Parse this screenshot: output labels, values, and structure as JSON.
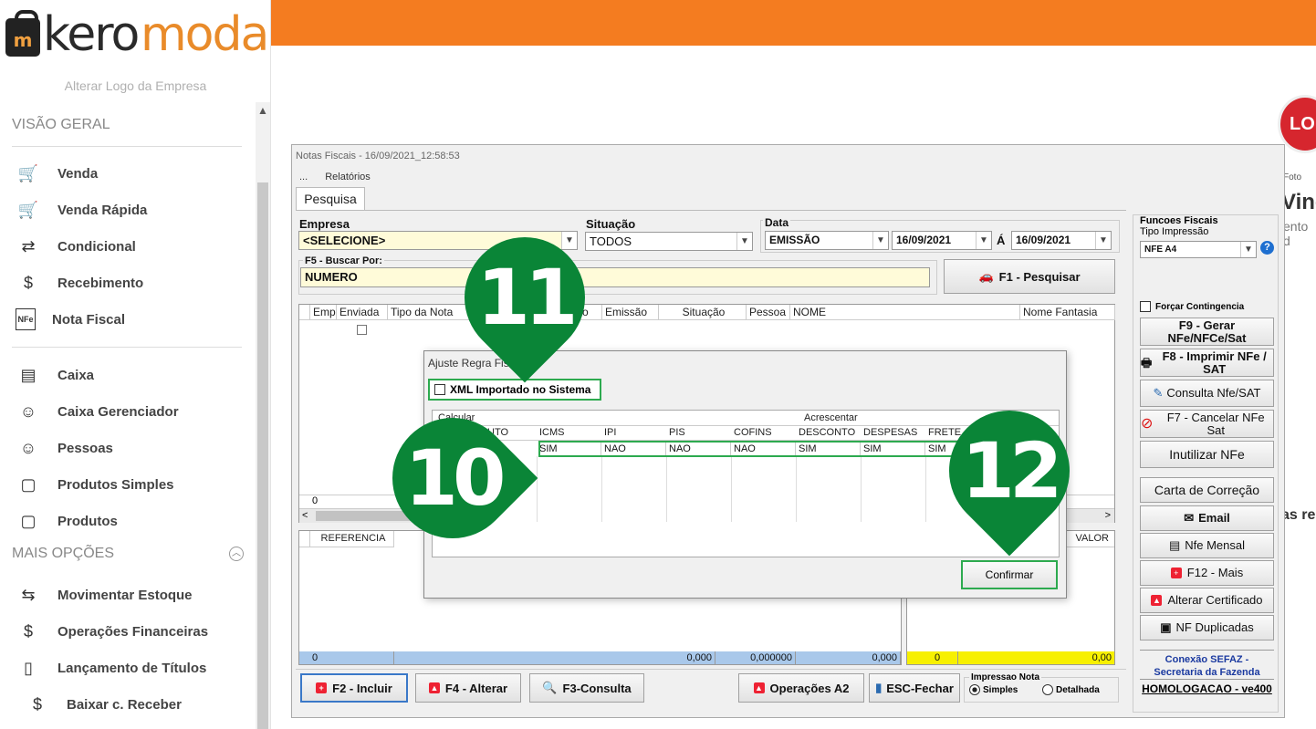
{
  "sidebar": {
    "logo": {
      "part1": "kero",
      "part2": "moda",
      "mark": "m"
    },
    "alter_logo": "Alterar Logo da Empresa",
    "section_overview": "VISÃO GERAL",
    "section_more": "MAIS OPÇÕES",
    "items_overview": [
      {
        "label": "Venda",
        "icon": "cart-icon"
      },
      {
        "label": "Venda Rápida",
        "icon": "cart-icon"
      },
      {
        "label": "Condicional",
        "icon": "cart-arrows-icon"
      },
      {
        "label": "Recebimento",
        "icon": "money-hand-icon"
      },
      {
        "label": "Nota Fiscal",
        "icon": "nfe-icon"
      },
      {
        "label": "Caixa",
        "icon": "cash-register-icon"
      },
      {
        "label": "Caixa Gerenciador",
        "icon": "user-money-icon"
      },
      {
        "label": "Pessoas",
        "icon": "people-icon"
      },
      {
        "label": "Produtos Simples",
        "icon": "box-icon"
      },
      {
        "label": "Produtos",
        "icon": "box-icon"
      }
    ],
    "items_more": [
      {
        "label": "Movimentar Estoque",
        "icon": "stock-move-icon"
      },
      {
        "label": "Operações Financeiras",
        "icon": "dollar-arrows-icon"
      },
      {
        "label": "Lançamento de Títulos",
        "icon": "document-dollar-icon"
      },
      {
        "label": "Baixar c. Receber",
        "icon": "money-hand-icon"
      }
    ]
  },
  "background": {
    "logo_text": "LO",
    "foto_label": "Foto",
    "vind_text": "Vind",
    "ento_text": "ento d",
    "asre_text": "as re"
  },
  "window": {
    "title": "Notas Fiscais - 16/09/2021_12:58:53",
    "menu": [
      "...",
      "Relatórios"
    ],
    "tab": "Pesquisa",
    "empresa_label": "Empresa",
    "empresa_value": "<SELECIONE>",
    "situacao_label": "Situação",
    "situacao_value": "TODOS",
    "data_label": "Data",
    "data_type": "EMISSÃO",
    "date_from": "16/09/2021",
    "date_sep": "Á",
    "date_to": "16/09/2021",
    "buscar_label": "F5 - Buscar Por:",
    "buscar_value": "NUMERO",
    "pesquisar_button": "F1 - Pesquisar",
    "grid_headers": [
      "Emp",
      "Enviada",
      "Tipo da Nota",
      "o",
      "Emissão",
      "Situação",
      "Pessoa",
      "NOME",
      "Nome Fantasia"
    ],
    "grid_count": "0",
    "grid2_header": "REFERENCIA",
    "grid3_header": "VALOR",
    "totals": {
      "t0": "0",
      "t1": "0,000",
      "t2": "0,000000",
      "t3": "0,000",
      "t4": "0",
      "t5": "0,00"
    },
    "right_panel": {
      "title": "Funcoes Fiscais",
      "tipo_label": "Tipo Impressão",
      "tipo_value": "NFE A4",
      "forcar": "Forçar Contingencia",
      "btn_f9": "F9 - Gerar NFe/NFCe/Sat",
      "btn_f8": "F8 - Imprimir NFe / SAT",
      "btn_consulta": "Consulta Nfe/SAT",
      "btn_f7": "F7 - Cancelar NFe Sat",
      "btn_inutilizar": "Inutilizar NFe",
      "btn_carta": "Carta de Correção",
      "btn_email": "Email",
      "btn_mensal": "Nfe Mensal",
      "btn_f12": "F12 - Mais",
      "btn_cert": "Alterar Certificado",
      "btn_dup": "NF Duplicadas",
      "sefaz": "Conexão SEFAZ - Secretaria da Fazenda",
      "env": "HOMOLOGACAO - ve400"
    },
    "bottom": {
      "incluir": "F2 - Incluir",
      "alterar": "F4 - Alterar",
      "consulta": "F3-Consulta",
      "operacoes": "Operações A2",
      "fechar": "ESC-Fechar",
      "impressao_label": "Impressao Nota",
      "simples": "Simples",
      "detalhada": "Detalhada"
    }
  },
  "dialog": {
    "title": "Ajuste Regra Fisca",
    "xml_check": "XML Importado no Sistema",
    "calcular": "Calcular",
    "acrescentar": "Acrescentar",
    "headers": [
      "UTO",
      "ICMS",
      "IPI",
      "PIS",
      "COFINS",
      "DESCONTO",
      "DESPESAS",
      "FRETE"
    ],
    "row": [
      "",
      "SIM",
      "NAO",
      "NAO",
      "NAO",
      "SIM",
      "SIM",
      "SIM"
    ],
    "confirm": "Confirmar"
  },
  "markers": [
    "11",
    "10",
    "12"
  ],
  "colors": {
    "accent": "#f47c20",
    "marker": "#0a8537",
    "highlight": "#2daa4f"
  }
}
